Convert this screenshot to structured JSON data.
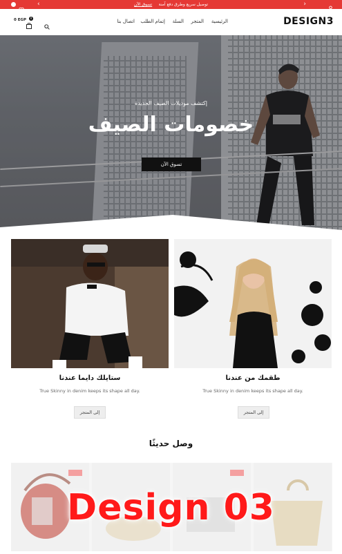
{
  "topbar": {
    "announcement": "توصيل سريع وطرق دفع آمنة",
    "cta": "تسوق الآن",
    "bg_color": "#e53935"
  },
  "header": {
    "logo": "DESIGN3",
    "nav": [
      "الرئيسية",
      "المتجر",
      "السلة",
      "إتمام الطلب",
      "اتصال بنا"
    ],
    "cart_amount": "0 EGP",
    "cart_count": "0"
  },
  "hero": {
    "subtitle": "إكتشف موديلات الصيف الجديدة",
    "title": "خصومات الصيف",
    "button": "تسوق الآن"
  },
  "promos": [
    {
      "title": "طقمك من عندنا",
      "desc": "True Skinny in denim keeps its shape all day.",
      "button": "إلى المتجر"
    },
    {
      "title": "ستايلك دايما عندنا",
      "desc": "True Skinny in denim keeps its shape all day.",
      "button": "إلى المتجر"
    }
  ],
  "recent": {
    "title": "وصل حديثًا"
  },
  "watermark": "Design 03"
}
